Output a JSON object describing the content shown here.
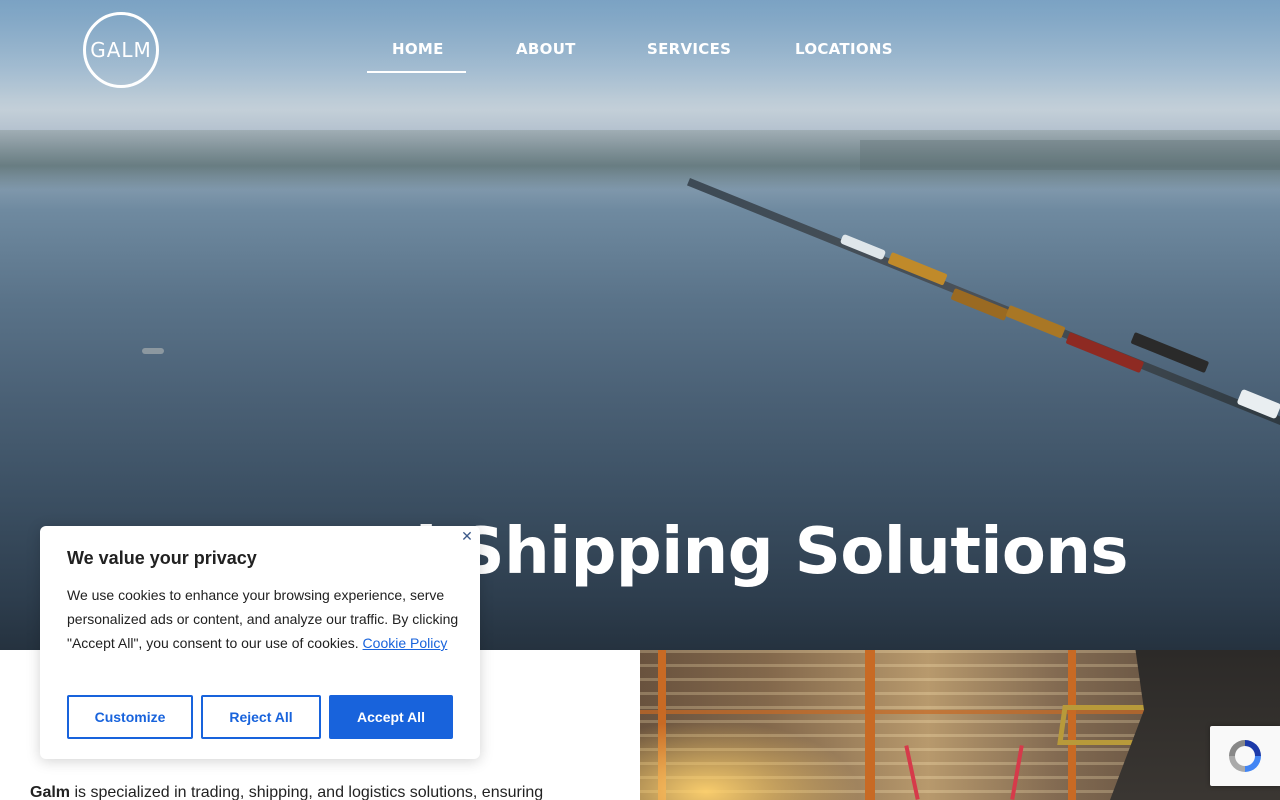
{
  "header": {
    "logo_text": "GALM",
    "nav": [
      {
        "label": "HOME",
        "active": true
      },
      {
        "label": "ABOUT",
        "active": false
      },
      {
        "label": "SERVICES",
        "active": false
      },
      {
        "label": "LOCATIONS",
        "active": false
      }
    ]
  },
  "hero": {
    "heading_visible": "nd Shipping Solutions"
  },
  "about": {
    "brand": "Galm",
    "text": " is specialized in trading, shipping, and logistics solutions, ensuring"
  },
  "cookie_banner": {
    "title": "We value your privacy",
    "body": "We use cookies to enhance your browsing experience, serve personalized ads or content, and analyze our traffic. By clicking \"Accept All\", you consent to our use of cookies. ",
    "link_label": "Cookie Policy",
    "close_icon": "close-icon",
    "buttons": {
      "customize": "Customize",
      "reject": "Reject All",
      "accept": "Accept All"
    },
    "accent_color": "#1863dc"
  },
  "recaptcha": {
    "icon": "recaptcha-icon"
  }
}
